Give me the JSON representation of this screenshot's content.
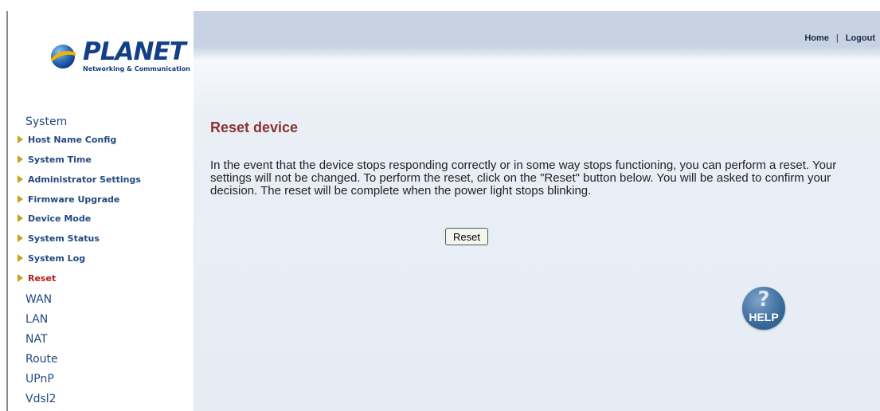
{
  "logo": {
    "name": "PLANET",
    "tagline": "Networking & Communication"
  },
  "topnav": {
    "home": "Home",
    "separator": "|",
    "logout": "Logout"
  },
  "sidebar": {
    "section": "System",
    "items": [
      {
        "label": "Host Name Config"
      },
      {
        "label": "System Time"
      },
      {
        "label": "Administrator Settings"
      },
      {
        "label": "Firmware Upgrade"
      },
      {
        "label": "Device Mode"
      },
      {
        "label": "System Status"
      },
      {
        "label": "System Log"
      },
      {
        "label": "Reset",
        "active": true
      }
    ],
    "top_items": [
      {
        "label": "WAN"
      },
      {
        "label": "LAN"
      },
      {
        "label": "NAT"
      },
      {
        "label": "Route"
      },
      {
        "label": "UPnP"
      },
      {
        "label": "Vdsl2"
      }
    ]
  },
  "main": {
    "title": "Reset device",
    "description": "In the event that the device stops responding correctly or in some way stops functioning, you can perform a reset. Your settings will not be changed. To perform the reset, click on the \"Reset\" button below. You will be asked to confirm your decision. The reset will be complete when the power light stops blinking.",
    "reset_button": "Reset",
    "help_icon_text": "HELP",
    "help_icon_glyph": "?"
  },
  "colors": {
    "brand": "#123f86",
    "nav_text": "#23497f",
    "active_item": "#b01c1c",
    "heading": "#8b3232",
    "bullet": "#c7a31a",
    "header_band": "#c7d2e2"
  }
}
